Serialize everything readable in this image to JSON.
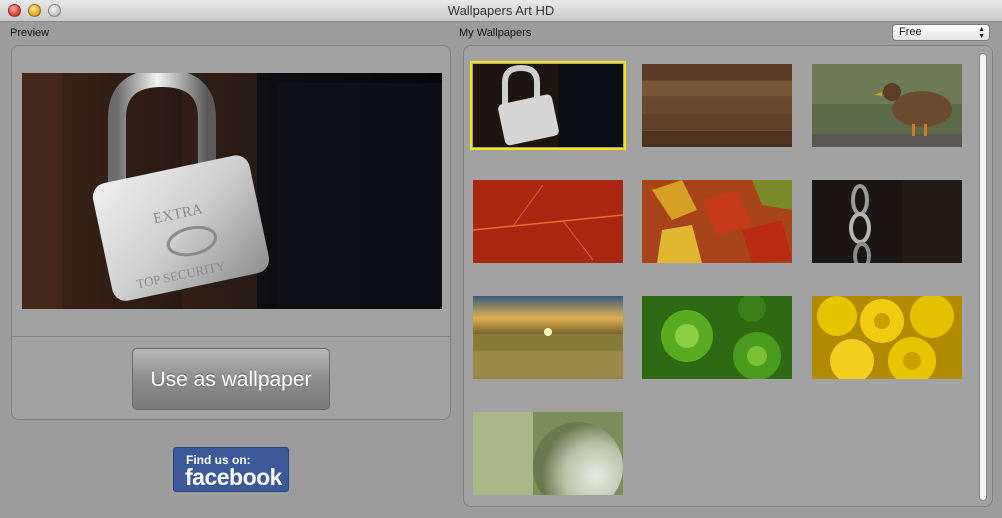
{
  "window": {
    "title": "Wallpapers Art HD"
  },
  "preview": {
    "label": "Preview",
    "lock_text_top": "EXTRA",
    "lock_text_bottom": "TOP SECURITY",
    "use_button_label": "Use as wallpaper"
  },
  "facebook": {
    "line1": "Find us on:",
    "line2": "facebook"
  },
  "wallpapers": {
    "label": "My Wallpapers",
    "filter_selected": "Free",
    "items": [
      {
        "name": "padlock",
        "selected": true
      },
      {
        "name": "wood-planks",
        "selected": false
      },
      {
        "name": "duck",
        "selected": false
      },
      {
        "name": "red-leaf",
        "selected": false
      },
      {
        "name": "autumn-leaves",
        "selected": false
      },
      {
        "name": "chain",
        "selected": false
      },
      {
        "name": "sunset-field",
        "selected": false
      },
      {
        "name": "succulents",
        "selected": false
      },
      {
        "name": "yellow-roses",
        "selected": false
      },
      {
        "name": "white-flower",
        "selected": false
      }
    ]
  },
  "colors": {
    "selection": "#ffe600",
    "facebook_blue": "#3b5998",
    "window_bg": "#9c9c9c"
  }
}
